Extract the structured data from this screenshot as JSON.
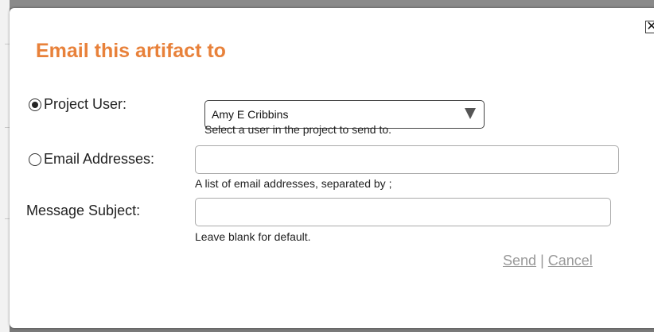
{
  "dialog": {
    "title": "Email this artifact to",
    "close_glyph": "✕"
  },
  "form": {
    "project_user": {
      "label": "Project User:",
      "selected": true,
      "value": "Amy E Cribbins",
      "hint": "Select a user in the project to send to."
    },
    "email_addresses": {
      "label": "Email Addresses:",
      "selected": false,
      "value": "",
      "hint": "A list of email addresses, separated by ;"
    },
    "message_subject": {
      "label": "Message Subject:",
      "value": "",
      "hint": "Leave blank for default."
    }
  },
  "actions": {
    "send_label": "Send",
    "separator": "|",
    "cancel_label": "Cancel"
  },
  "colors": {
    "title": "#e8813a",
    "link": "#999999"
  },
  "icons": {
    "close": "close-icon",
    "dropdown": "chevron-down-icon"
  }
}
